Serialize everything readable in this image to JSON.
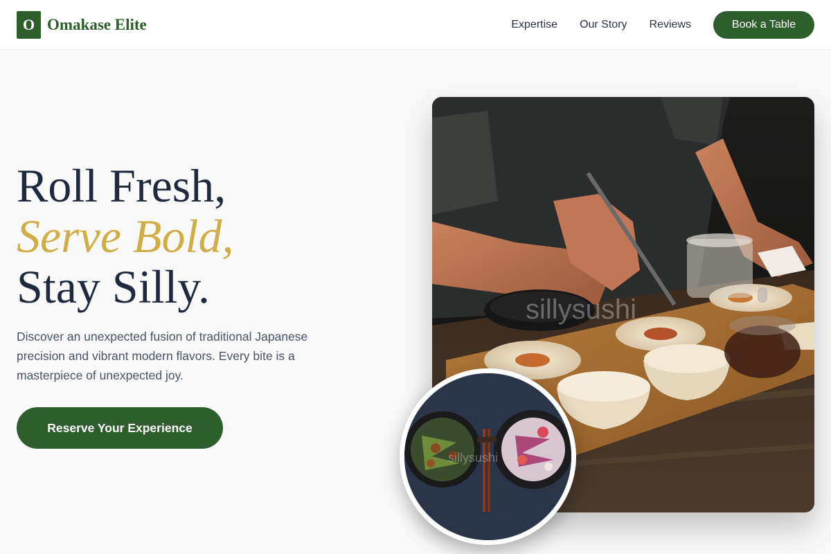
{
  "brand": {
    "logo_letter": "O",
    "name": "Omakase Elite"
  },
  "nav": {
    "links": [
      "Expertise",
      "Our Story",
      "Reviews"
    ],
    "cta": "Book a Table"
  },
  "hero": {
    "title_line1": "Roll Fresh,",
    "title_line2": "Serve Bold,",
    "title_line3": "Stay Silly.",
    "description": "Discover an unexpected fusion of traditional Japanese precision and vibrant modern flavors. Every bite is a masterpiece of unexpected joy.",
    "cta": "Reserve Your Experience"
  },
  "images": {
    "main_watermark": "sillysushi",
    "bowls_watermark": "sillysushi"
  },
  "colors": {
    "brand_green": "#2e5e2b",
    "accent_gold": "#d0ad45",
    "heading_navy": "#1f2a3c",
    "background": "#f9f9f9"
  },
  "icons": {
    "logo": "logo-letter-o-icon"
  }
}
